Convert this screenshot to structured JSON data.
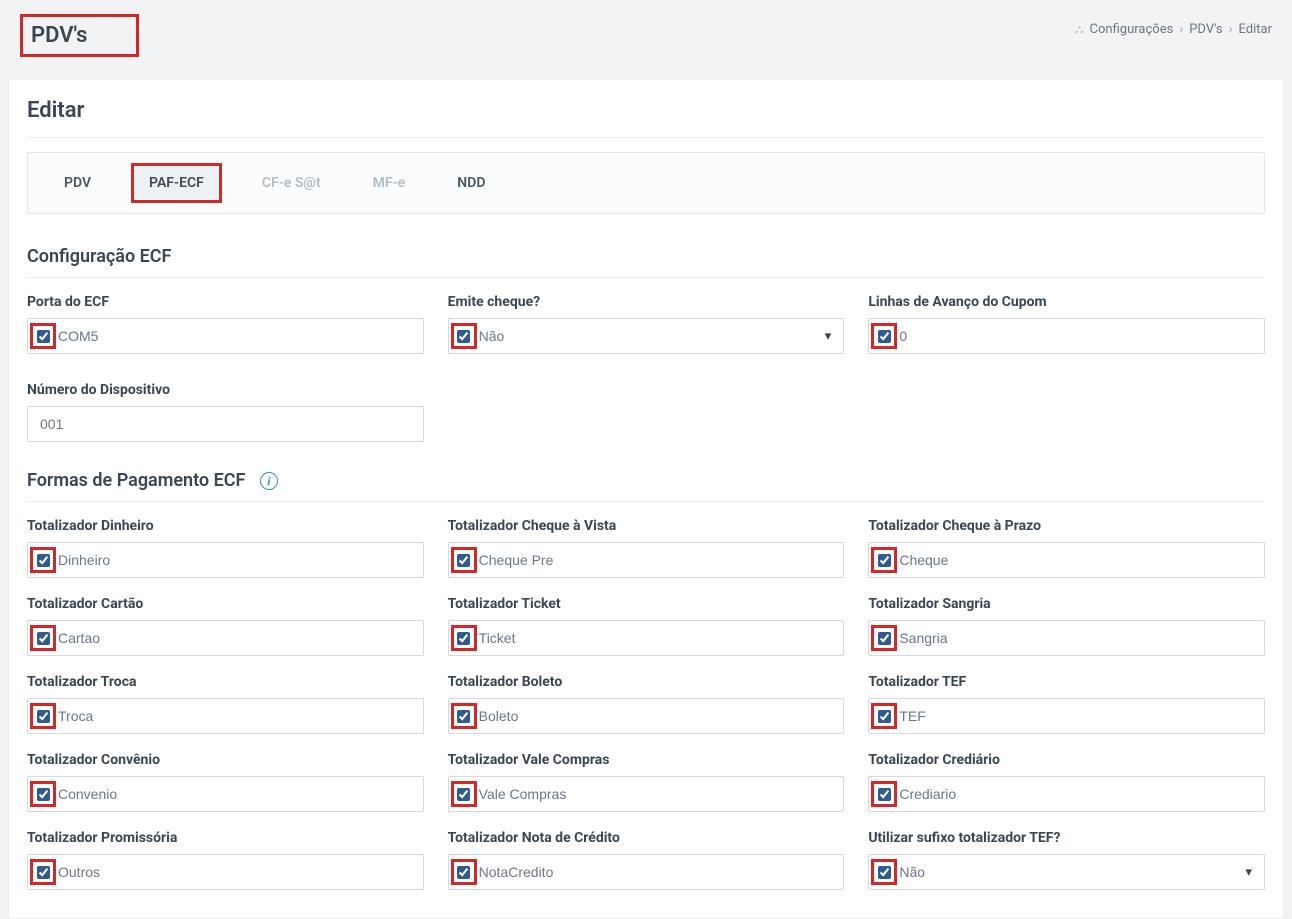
{
  "header": {
    "title": "PDV's",
    "breadcrumb": {
      "root": "Configurações",
      "mid": "PDV's",
      "leaf": "Editar"
    }
  },
  "card": {
    "title": "Editar"
  },
  "tabs": {
    "pdv": "PDV",
    "paf_ecf": "PAF-ECF",
    "cfe_sat": "CF-e S@t",
    "mfe": "MF-e",
    "ndd": "NDD"
  },
  "sections": {
    "ecf": {
      "title": "Configuração ECF",
      "porta_label": "Porta do ECF",
      "porta_value": "COM5",
      "emite_cheque_label": "Emite cheque?",
      "emite_cheque_value": "Não",
      "linhas_label": "Linhas de Avanço do Cupom",
      "linhas_value": "0",
      "numero_disp_label": "Número do Dispositivo",
      "numero_disp_value": "001"
    },
    "formas": {
      "title": "Formas de Pagamento ECF",
      "dinheiro_label": "Totalizador Dinheiro",
      "dinheiro_value": "Dinheiro",
      "cheque_vista_label": "Totalizador Cheque à Vista",
      "cheque_vista_value": "Cheque Pre",
      "cheque_prazo_label": "Totalizador Cheque à Prazo",
      "cheque_prazo_value": "Cheque",
      "cartao_label": "Totalizador Cartão",
      "cartao_value": "Cartao",
      "ticket_label": "Totalizador Ticket",
      "ticket_value": "Ticket",
      "sangria_label": "Totalizador Sangria",
      "sangria_value": "Sangria",
      "troca_label": "Totalizador Troca",
      "troca_value": "Troca",
      "boleto_label": "Totalizador Boleto",
      "boleto_value": "Boleto",
      "tef_label": "Totalizador TEF",
      "tef_value": "TEF",
      "convenio_label": "Totalizador Convênio",
      "convenio_value": "Convenio",
      "vale_label": "Totalizador Vale Compras",
      "vale_value": "Vale Compras",
      "crediario_label": "Totalizador Crediário",
      "crediario_value": "Crediario",
      "promissoria_label": "Totalizador Promissória",
      "promissoria_value": "Outros",
      "nota_credito_label": "Totalizador Nota de Crédito",
      "nota_credito_value": "NotaCredito",
      "sufixo_label": "Utilizar sufixo totalizador TEF?",
      "sufixo_value": "Não"
    }
  }
}
